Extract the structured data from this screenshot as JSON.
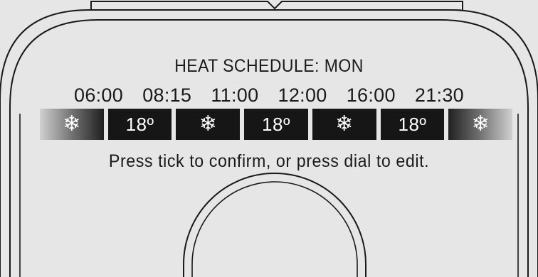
{
  "screen": {
    "title": "HEAT SCHEDULE: MON",
    "times": [
      "06:00",
      "08:15",
      "11:00",
      "12:00",
      "16:00",
      "21:30"
    ],
    "segments": [
      {
        "kind": "frost",
        "icon": "snowflake-icon",
        "glyph": "❄"
      },
      {
        "kind": "heat",
        "label": "18º"
      },
      {
        "kind": "frost",
        "icon": "snowflake-icon",
        "glyph": "❄"
      },
      {
        "kind": "heat",
        "label": "18º"
      },
      {
        "kind": "frost",
        "icon": "snowflake-icon",
        "glyph": "❄"
      },
      {
        "kind": "heat",
        "label": "18º"
      },
      {
        "kind": "frost",
        "icon": "snowflake-icon",
        "glyph": "❄"
      }
    ],
    "hint": "Press tick to confirm, or press dial to edit."
  },
  "colors": {
    "background": "#e6e6e6",
    "segment": "#161616",
    "text": "#1a1a1a"
  }
}
